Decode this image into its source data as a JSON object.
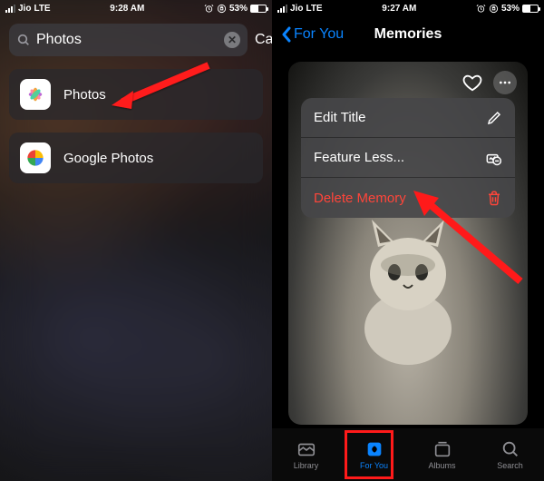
{
  "left": {
    "status": {
      "carrier": "Jio",
      "net": "LTE",
      "time": "9:28 AM",
      "battery": "53%"
    },
    "search": {
      "value": "Photos",
      "cancel": "Cancel"
    },
    "results": [
      {
        "name": "Photos"
      },
      {
        "name": "Google Photos"
      }
    ]
  },
  "right": {
    "status": {
      "carrier": "Jio",
      "net": "LTE",
      "time": "9:27 AM",
      "battery": "53%"
    },
    "nav": {
      "back": "For You",
      "title": "Memories"
    },
    "menu": {
      "edit_title": "Edit Title",
      "feature_less": "Feature Less...",
      "delete": "Delete Memory"
    },
    "tabs": {
      "library": "Library",
      "for_you": "For You",
      "albums": "Albums",
      "search": "Search"
    }
  }
}
